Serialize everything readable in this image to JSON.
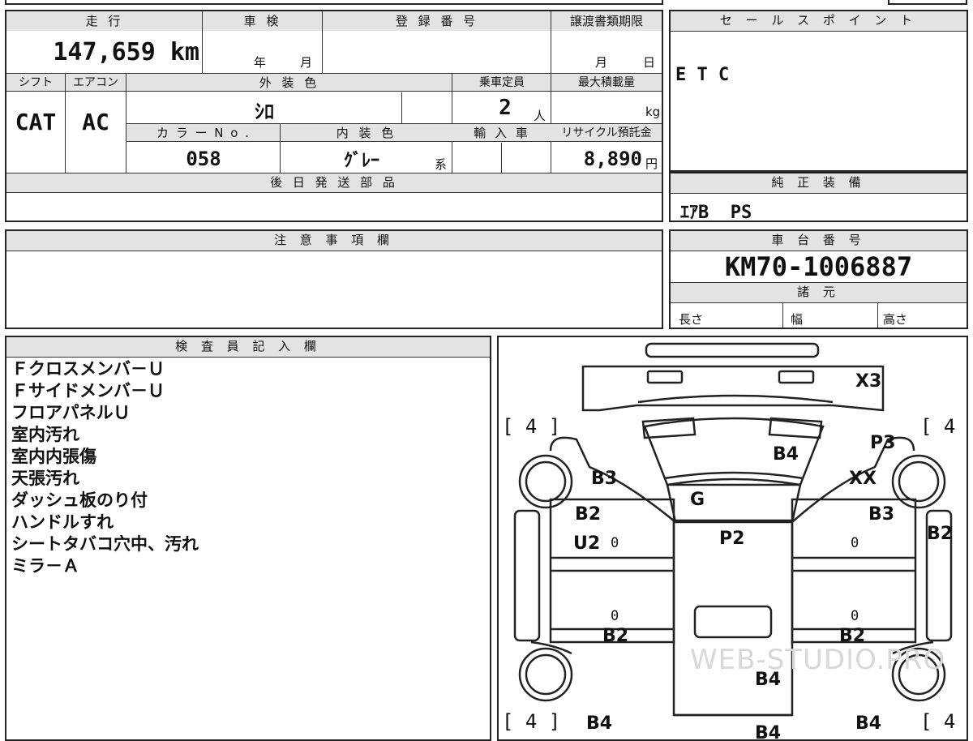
{
  "vehicle_info": {
    "mileage_label": "走 行",
    "mileage_value": "147,659 km",
    "inspection_label": "車 検",
    "inspection_year_unit": "年",
    "inspection_month_unit": "月",
    "registration_label": "登 録 番 号",
    "transfer_deadline_label": "譲渡書類期限",
    "transfer_month_unit": "月",
    "transfer_day_unit": "日",
    "shift_label": "シフト",
    "shift_value": "CAT",
    "ac_label": "エアコン",
    "ac_value": "AC",
    "exterior_color_label": "外 装 色",
    "exterior_color_value": "ｼﾛ",
    "capacity_label": "乗車定員",
    "capacity_value": "2",
    "capacity_unit": "人",
    "max_load_label": "最大積載量",
    "max_load_unit": "kg",
    "color_no_label": "カ ラ ー N o .",
    "color_no_value": "058",
    "interior_color_label": "内 装 色",
    "interior_color_value": "ｸﾞﾚｰ",
    "interior_color_suffix": "系",
    "import_label": "輸 入 車",
    "recycle_label": "リサイクル預託金",
    "recycle_value": "8,890",
    "recycle_unit": "円",
    "later_parts_label": "後 日 発 送 部 品"
  },
  "sales_point": {
    "label": "セ ー ル ス ポ イ ン ト",
    "value": "E T C"
  },
  "genuine_equipment": {
    "label": "純 正 装 備",
    "value": "ｴｱB  PS"
  },
  "caution": {
    "label": "注 意 事 項 欄"
  },
  "chassis": {
    "label": "車 台 番 号",
    "value": "KM70-1006887",
    "specs_label": "諸 元",
    "length_label": "長さ",
    "width_label": "幅",
    "height_label": "高さ"
  },
  "inspector": {
    "label": "検 査 員 記 入 欄",
    "notes": [
      "Ｆクロスメンバ－Ｕ",
      "Ｆサイドメンバ－Ｕ",
      "フロアパネルＵ",
      "室内汚れ",
      "室内内張傷",
      "天張汚れ",
      "ダッシュ板のり付",
      "ハンドルすれ",
      "シートタバコ穴中、汚れ",
      "ミラ－Ａ"
    ]
  },
  "diagram": {
    "watermark": "WEB-STUDIO.PRO",
    "bracket_text": "[ 4 ]",
    "marks": {
      "x3": "X3",
      "b4_hood": "B4",
      "p3": "P3",
      "b3_left": "B3",
      "xx": "XX",
      "g": "G",
      "b2_left_front": "B2",
      "u2": "U2",
      "p2": "P2",
      "b3_right": "B3",
      "b2_right_side": "B2",
      "b2_left_rocker": "B2",
      "b2_right_rocker": "B2",
      "b4_roof": "B4",
      "b4_rear_left": "B4",
      "b4_rear_center": "B4",
      "b4_rear_right": "B4",
      "zero": "0"
    }
  }
}
